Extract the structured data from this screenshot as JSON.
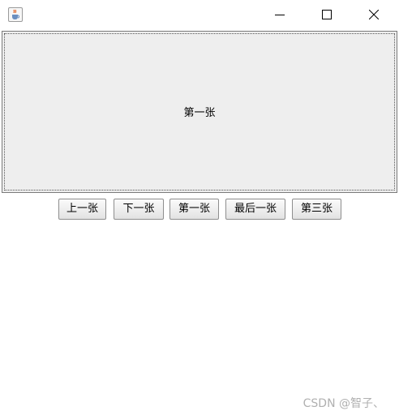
{
  "window": {
    "icon": "java-cup-icon",
    "controls": [
      "minimize-icon",
      "maximize-icon",
      "close-icon"
    ]
  },
  "content": {
    "label": "第一张"
  },
  "buttons": {
    "prev": "上一张",
    "next": "下一张",
    "first": "第一张",
    "last": "最后一张",
    "third": "第三张"
  },
  "watermark": "CSDN @智子、"
}
